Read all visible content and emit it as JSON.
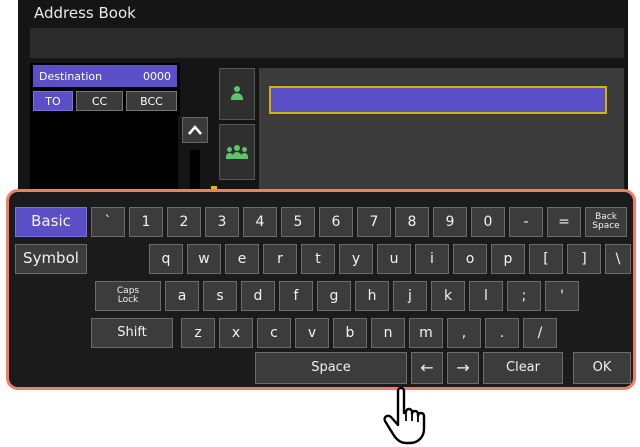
{
  "header": {
    "title": "Address Book"
  },
  "destination": {
    "label": "Destination",
    "count": "0000"
  },
  "tabs": [
    "TO",
    "CC",
    "BCC"
  ],
  "search": {
    "value": ""
  },
  "scroll": {
    "up_glyph": "⌃"
  },
  "keyboard": {
    "modes": {
      "basic": "Basic",
      "symbol": "Symbol"
    },
    "row1": [
      "`",
      "1",
      "2",
      "3",
      "4",
      "5",
      "6",
      "7",
      "8",
      "9",
      "0",
      "-",
      "="
    ],
    "backspace": [
      "Back",
      "Space"
    ],
    "row2": [
      "q",
      "w",
      "e",
      "r",
      "t",
      "y",
      "u",
      "i",
      "o",
      "p",
      "[",
      "]",
      "\\"
    ],
    "caps": [
      "Caps",
      "Lock"
    ],
    "row3": [
      "a",
      "s",
      "d",
      "f",
      "g",
      "h",
      "j",
      "k",
      "l",
      ";",
      "'"
    ],
    "shift": "Shift",
    "row4": [
      "z",
      "x",
      "c",
      "v",
      "b",
      "n",
      "m",
      ",",
      ".",
      "/"
    ],
    "space": "Space",
    "left_arrow": "←",
    "right_arrow": "→",
    "clear": "Clear",
    "ok": "OK"
  },
  "icons": {
    "person": "person-icon",
    "group": "group-icon",
    "hand": "hand-pointer-icon"
  },
  "colors": {
    "accent": "#5a4fc6",
    "highlight_border": "#ef7d68",
    "focus_border": "#d5b400",
    "icon_green": "#5dc46b"
  }
}
